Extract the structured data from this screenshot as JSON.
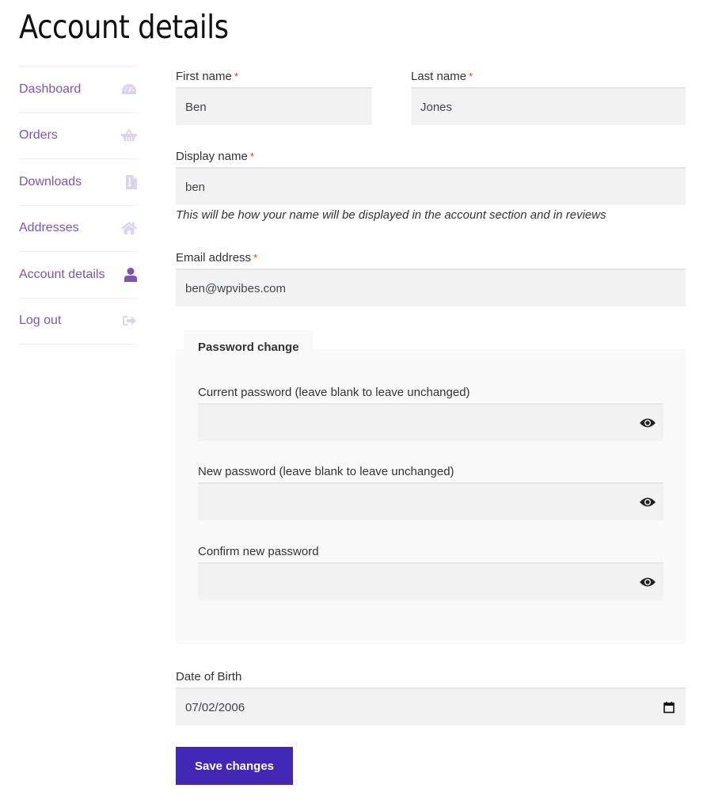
{
  "page": {
    "title": "Account details"
  },
  "colors": {
    "link": "#7f54b3",
    "required": "#e2401c",
    "button": "#4328b7",
    "input_bg": "#f2f2f2",
    "fieldset_bg": "#f9f9f9"
  },
  "sidebar": {
    "items": [
      {
        "label": "Dashboard",
        "icon": "dashboard-gauge-icon",
        "active": false
      },
      {
        "label": "Orders",
        "icon": "basket-icon",
        "active": false
      },
      {
        "label": "Downloads",
        "icon": "file-download-icon",
        "active": false
      },
      {
        "label": "Addresses",
        "icon": "home-icon",
        "active": false
      },
      {
        "label": "Account details",
        "icon": "user-icon",
        "active": true
      },
      {
        "label": "Log out",
        "icon": "logout-icon",
        "active": false
      }
    ]
  },
  "form": {
    "required_mark": "*",
    "first_name": {
      "label": "First name",
      "value": "Ben"
    },
    "last_name": {
      "label": "Last name",
      "value": "Jones"
    },
    "display_name": {
      "label": "Display name",
      "value": "ben",
      "hint": "This will be how your name will be displayed in the account section and in reviews"
    },
    "email": {
      "label": "Email address",
      "value": "ben@wpvibes.com"
    },
    "password_change": {
      "legend": "Password change",
      "current": {
        "label": "Current password (leave blank to leave unchanged)",
        "value": ""
      },
      "new": {
        "label": "New password (leave blank to leave unchanged)",
        "value": ""
      },
      "confirm": {
        "label": "Confirm new password",
        "value": ""
      }
    },
    "dob": {
      "label": "Date of Birth",
      "value": "07/02/2006"
    },
    "save_label": "Save changes"
  }
}
